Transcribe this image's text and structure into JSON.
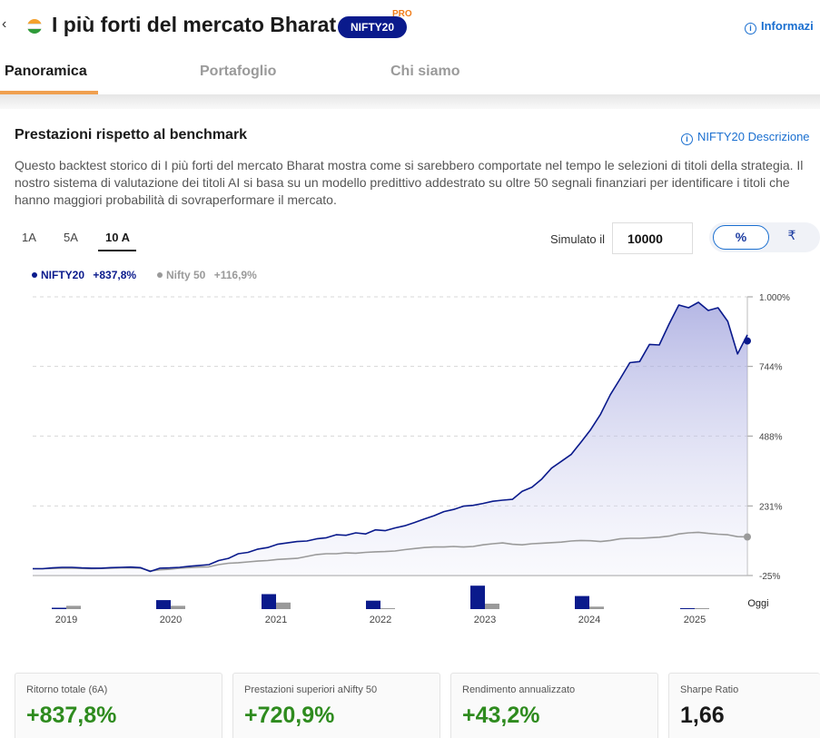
{
  "header": {
    "back_glyph": "‹",
    "title": "I più forti del mercato Bharat",
    "badge": "NIFTY20",
    "pro": "PRO",
    "info_link": "Informazi"
  },
  "tabs": [
    {
      "label": "Panoramica",
      "active": true
    },
    {
      "label": "Portafoglio",
      "active": false
    },
    {
      "label": "Chi siamo",
      "active": false
    }
  ],
  "section": {
    "title": "Prestazioni rispetto al benchmark",
    "desc_link": "NIFTY20 Descrizione",
    "description": "Questo backtest storico di I più forti del mercato Bharat mostra come si sarebbero comportate nel tempo le selezioni di titoli della strategia. Il nostro sistema di valutazione dei titoli AI si basa su un modello predittivo addestrato su oltre 50 segnali finanziari per identificare i titoli che hanno maggiori probabilità di sovraperformare il mercato."
  },
  "periods": [
    {
      "label": "1A",
      "active": false
    },
    {
      "label": "5A",
      "active": false
    },
    {
      "label": "10 A",
      "active": true
    }
  ],
  "simulator": {
    "label": "Simulato il",
    "value": "10000",
    "toggle_pct": "%",
    "toggle_rs": "₹"
  },
  "legend": [
    {
      "name": "NIFTY20",
      "value": "+837,8%",
      "color": "#0a1a8c"
    },
    {
      "name": "Nifty 50",
      "value": "+116,9%",
      "color": "#9a9a9a"
    }
  ],
  "chart_data": {
    "type": "area",
    "series": [
      {
        "name": "NIFTY20",
        "color": "#0a1a8c",
        "values": [
          0,
          0,
          3,
          5,
          5,
          3,
          2,
          2,
          4,
          5,
          6,
          4,
          -10,
          2,
          3,
          5,
          9,
          12,
          15,
          30,
          38,
          55,
          60,
          72,
          78,
          90,
          95,
          100,
          102,
          110,
          114,
          125,
          123,
          132,
          128,
          143,
          140,
          150,
          158,
          170,
          183,
          195,
          210,
          218,
          230,
          233,
          240,
          248,
          252,
          255,
          285,
          300,
          330,
          370,
          395,
          420,
          465,
          512,
          568,
          640,
          698,
          758,
          762,
          825,
          823,
          900,
          970,
          960,
          980,
          950,
          960,
          910,
          790,
          860
        ],
        "end_value": 837.8
      },
      {
        "name": "Nifty 50",
        "color": "#9a9a9a",
        "values": [
          0,
          0,
          1,
          2,
          2,
          1,
          0,
          1,
          2,
          3,
          3,
          2,
          -8,
          -4,
          -2,
          2,
          4,
          6,
          7,
          15,
          20,
          22,
          25,
          28,
          30,
          34,
          36,
          38,
          45,
          52,
          55,
          55,
          58,
          57,
          60,
          62,
          63,
          65,
          70,
          74,
          78,
          80,
          80,
          82,
          80,
          82,
          88,
          92,
          95,
          90,
          88,
          92,
          94,
          96,
          98,
          102,
          104,
          103,
          100,
          104,
          110,
          112,
          112,
          114,
          116,
          120,
          128,
          132,
          134,
          130,
          127,
          125,
          118,
          117
        ],
        "end_value": 116.9
      }
    ],
    "y_ticks": [
      "1.000%",
      "744%",
      "488%",
      "231%",
      "-25%"
    ],
    "y_tick_values": [
      1000,
      744,
      488,
      231,
      -25
    ],
    "ylim": [
      -25,
      1000
    ],
    "x_years": [
      "2019",
      "2020",
      "2021",
      "2022",
      "2023",
      "2024",
      "2025"
    ],
    "x_end_label": "Oggi",
    "annual_returns": [
      {
        "year": "2019",
        "nifty20": 5,
        "nifty50": 12
      },
      {
        "year": "2020",
        "nifty20": 33,
        "nifty50": 12
      },
      {
        "year": "2021",
        "nifty20": 55,
        "nifty50": 24
      },
      {
        "year": "2022",
        "nifty20": 31,
        "nifty50": 3
      },
      {
        "year": "2023",
        "nifty20": 86,
        "nifty50": 20
      },
      {
        "year": "2024",
        "nifty20": 48,
        "nifty50": 9
      },
      {
        "year": "2025",
        "nifty20": 0.5,
        "nifty50": 1
      }
    ],
    "grid": true,
    "legend_position": "top-left"
  },
  "stats": [
    {
      "label": "Ritorno totale (6A)",
      "value": "+837,8%",
      "positive": true
    },
    {
      "label": "Prestazioni superiori aNifty 50",
      "value": "+720,9%",
      "positive": true
    },
    {
      "label": "Rendimento annualizzato",
      "value": "+43,2%",
      "positive": true
    },
    {
      "label": "Sharpe Ratio",
      "value": "1,66",
      "positive": false
    }
  ]
}
